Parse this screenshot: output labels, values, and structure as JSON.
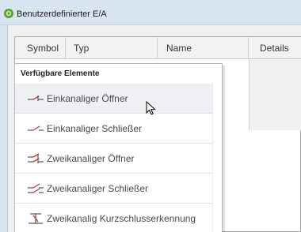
{
  "window": {
    "title": "Benutzerdefinierter E/A"
  },
  "table": {
    "columns": [
      "Symbol",
      "Typ",
      "Name",
      "Details"
    ]
  },
  "popup": {
    "header": "Verfügbare Elemente",
    "items": [
      {
        "label": "Einkanaliger Öffner",
        "icon": "single-channel-nc-contact-icon",
        "hovered": true
      },
      {
        "label": "Einkanaliger Schließer",
        "icon": "single-channel-no-contact-icon",
        "hovered": false
      },
      {
        "label": "Zweikanaliger Öffner",
        "icon": "dual-channel-nc-contact-icon",
        "hovered": false
      },
      {
        "label": "Zweikanaliger Schließer",
        "icon": "dual-channel-no-contact-icon",
        "hovered": false
      },
      {
        "label": "Zweikanalig Kurzschlusserkennung",
        "icon": "dual-channel-short-circuit-detection-icon",
        "hovered": false
      }
    ]
  },
  "colors": {
    "titlebar": "#d9e4f1",
    "icon_accent": "#c0392b",
    "app_icon": "#5aa02c"
  }
}
